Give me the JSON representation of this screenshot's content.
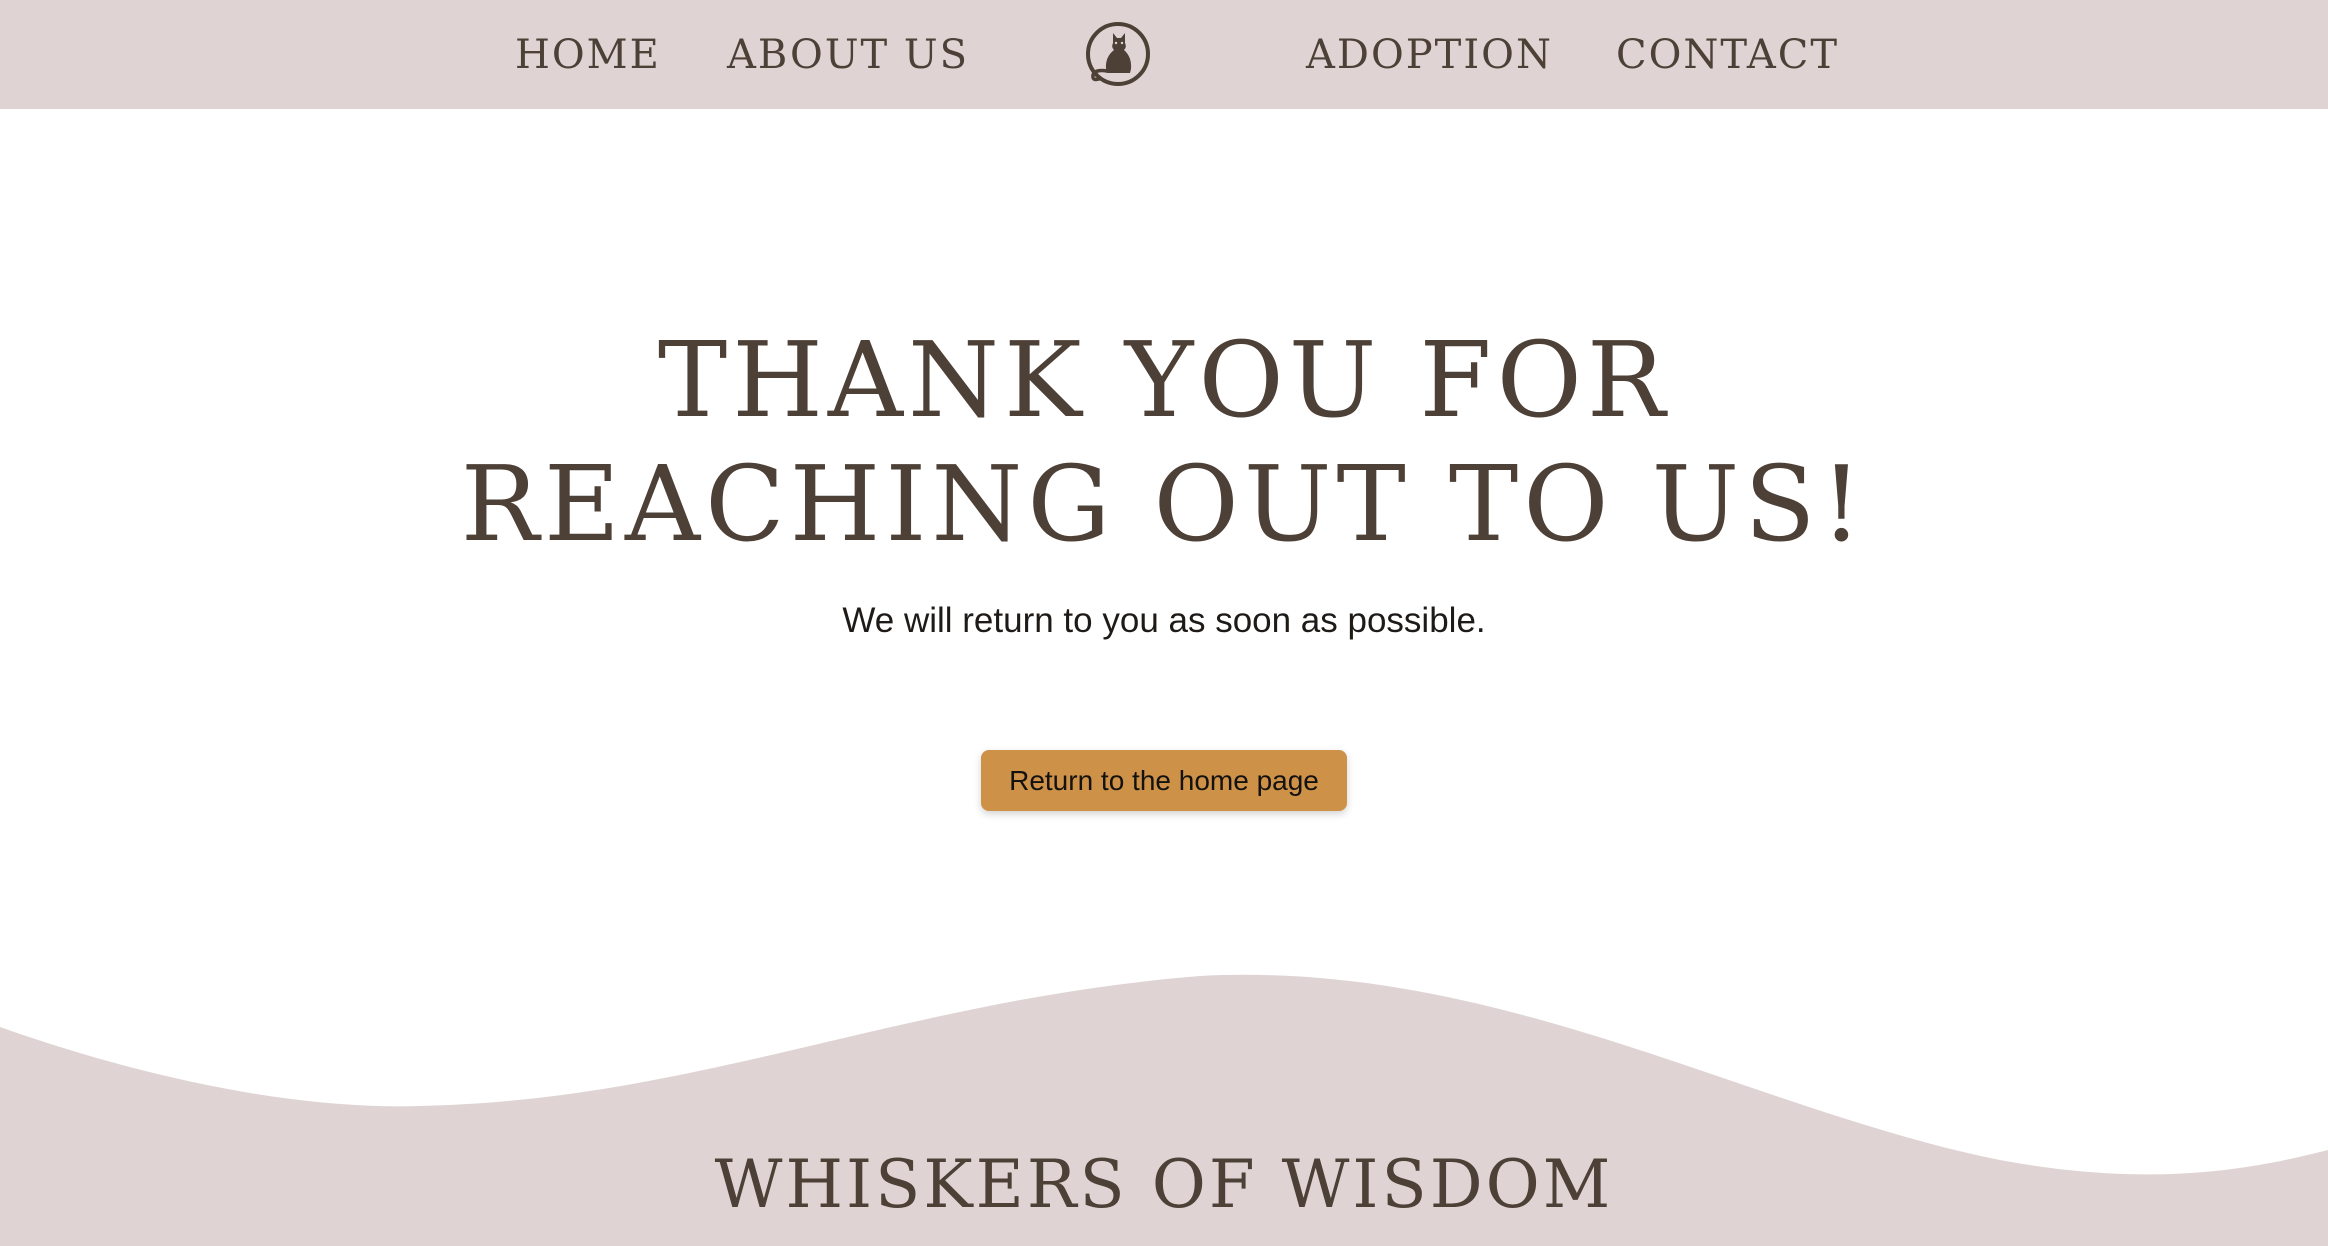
{
  "nav": {
    "home": "HOME",
    "about": "ABOUT US",
    "adoption": "ADOPTION",
    "contact": "CONTACT",
    "logo_icon": "cat-logo-icon"
  },
  "hero": {
    "title_line1": "THANK YOU FOR",
    "title_line2": "REACHING OUT TO US!",
    "subtitle": "We will return to you as soon as possible.",
    "button_label": "Return to the home page"
  },
  "footer": {
    "title": "WHISKERS OF WISDOM"
  },
  "colors": {
    "nav_bg": "#dfd4d3",
    "text_dark": "#4d4037",
    "button_bg": "#cd9148",
    "page_bg": "#ffffff"
  }
}
